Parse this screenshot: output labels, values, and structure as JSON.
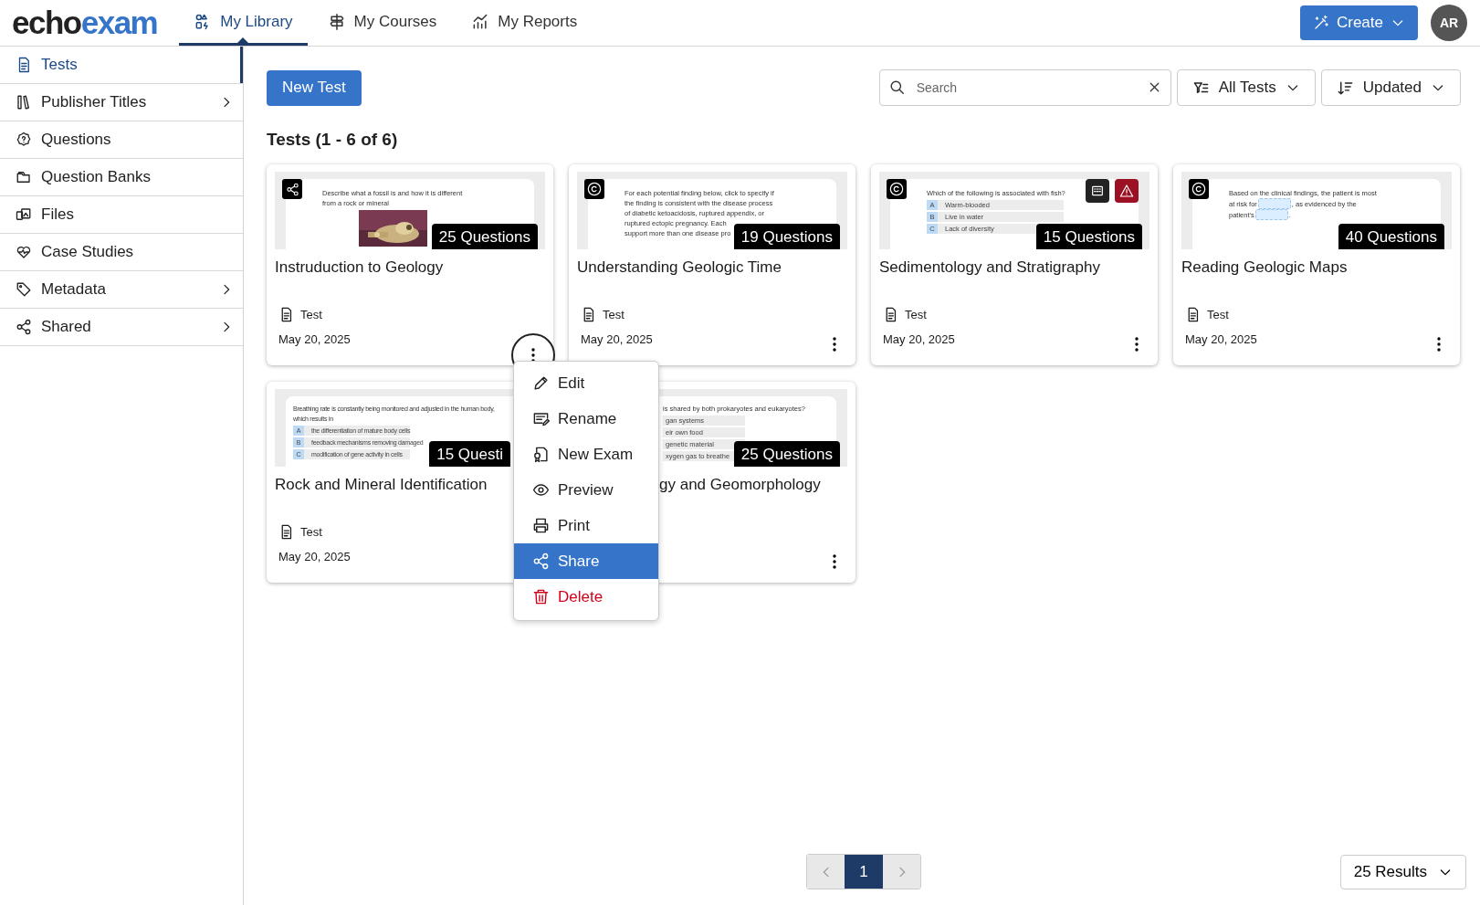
{
  "header": {
    "logo": [
      "echo",
      "exam"
    ],
    "nav": [
      {
        "label": "My Library",
        "selected": true
      },
      {
        "label": "My Courses",
        "selected": false
      },
      {
        "label": "My Reports",
        "selected": false
      }
    ],
    "create_button": "Create",
    "avatar": "AR"
  },
  "sidebar": {
    "items": [
      {
        "label": "Tests",
        "selected": true,
        "has_children": false
      },
      {
        "label": "Publisher Titles",
        "selected": false,
        "has_children": true
      },
      {
        "label": "Questions",
        "selected": false,
        "has_children": false
      },
      {
        "label": "Question Banks",
        "selected": false,
        "has_children": false
      },
      {
        "label": "Files",
        "selected": false,
        "has_children": false
      },
      {
        "label": "Case Studies",
        "selected": false,
        "has_children": false
      },
      {
        "label": "Metadata",
        "selected": false,
        "has_children": true
      },
      {
        "label": "Shared",
        "selected": false,
        "has_children": true
      }
    ]
  },
  "toolbar": {
    "new_button": "New Test",
    "search": {
      "placeholder": "Search"
    },
    "filter": "All Tests",
    "sort": "Updated"
  },
  "heading": "Tests (1 - 6 of 6)",
  "cards": [
    {
      "title": "Instruduction to Geology",
      "shared": true,
      "questions": "25 Questions",
      "type": "Test",
      "date": "May 20, 2025",
      "focused": true,
      "preview": {
        "lines": [
          [
            {
              "kind": "text",
              "text": "Describe what a fossil is and how it is different"
            }
          ],
          [
            {
              "kind": "text",
              "text": "from a rock or mineral"
            }
          ]
        ],
        "image": true
      }
    },
    {
      "title": "Understanding Geologic Time",
      "copyrighted": true,
      "questions": "19 Questions",
      "type": "Test",
      "date": "May 20, 2025",
      "preview": {
        "lines": [
          [
            {
              "kind": "text",
              "text": "For each potential finding below, click to specify if"
            }
          ],
          [
            {
              "kind": "text",
              "text": "the finding is consistent with the disease process"
            }
          ],
          [
            {
              "kind": "text",
              "text": "of diabetic ketoacidosis, ruptured appendix, or"
            }
          ],
          [
            {
              "kind": "text",
              "text": "ruptured ectopic pregnancy. Each"
            }
          ],
          [
            {
              "kind": "text",
              "text": "support more than one disease pro"
            }
          ]
        ]
      }
    },
    {
      "title": "Sedimentology and Stratigraphy",
      "copyrighted": true,
      "questions": "15 Questions",
      "type": "Test",
      "date": "May 20, 2025",
      "calculator": true,
      "warning": true,
      "preview": {
        "lines": [
          [
            {
              "kind": "text",
              "text": "Which of the following is associated with fish?"
            }
          ]
        ],
        "options": [
          {
            "letter": "A",
            "text": "Warm-blooded"
          },
          {
            "letter": "B",
            "text": "Live in water"
          },
          {
            "letter": "C",
            "text": "Lack of diversity"
          }
        ]
      }
    },
    {
      "title": "Reading Geologic Maps",
      "copyrighted": true,
      "questions": "40 Questions",
      "type": "Test",
      "date": "May 20, 2025",
      "preview": {
        "lines": [
          [
            {
              "kind": "text",
              "text": "Based on the clinical findings, the patient is most"
            }
          ],
          [
            {
              "kind": "text",
              "text": "at risk for"
            },
            {
              "kind": "blank"
            },
            {
              "kind": "text",
              "text": ", as evidenced by the"
            }
          ],
          [
            {
              "kind": "text",
              "text": "patient's"
            },
            {
              "kind": "blank"
            },
            {
              "kind": "text",
              "text": "."
            }
          ]
        ]
      }
    },
    {
      "title": "Rock and Mineral Identification",
      "questions": "15 Questi",
      "type": "Test",
      "date": "May 20, 2025",
      "right_covered": true,
      "preview": {
        "lines": [
          [
            {
              "kind": "text",
              "text": "Breathing rate is constantly being monitored and adjusted in the human body,"
            }
          ],
          [
            {
              "kind": "text",
              "text": "which results in"
            }
          ]
        ],
        "options": [
          {
            "letter": "A",
            "text": "the differentiation of mature body cells"
          },
          {
            "letter": "B",
            "text": "feedback mechanisms removing damaged"
          },
          {
            "letter": "C",
            "text": "modification of gene activity in cells"
          }
        ]
      }
    },
    {
      "title": "gy and Geomorphology",
      "questions": "25 Questions",
      "left_covered": true,
      "preview": {
        "lines": [
          [
            {
              "kind": "text",
              "text": "is shared by both prokaryotes and eukaryotes?"
            }
          ]
        ],
        "options": [
          {
            "text": "gan systems"
          },
          {
            "text": "eir own food"
          },
          {
            "text": "genetic material"
          },
          {
            "text": "xygen gas to breathe"
          }
        ]
      }
    }
  ],
  "menu": {
    "items": [
      {
        "label": "Edit",
        "kind": "normal",
        "selected": false
      },
      {
        "label": "Rename",
        "kind": "normal",
        "selected": false
      },
      {
        "label": "New Exam",
        "kind": "normal",
        "selected": false
      },
      {
        "label": "Preview",
        "kind": "normal",
        "selected": false
      },
      {
        "label": "Print",
        "kind": "normal",
        "selected": false
      },
      {
        "label": "Share",
        "kind": "normal",
        "selected": true
      },
      {
        "label": "Delete",
        "kind": "danger",
        "selected": false
      }
    ]
  },
  "pagination": {
    "prev_disabled": true,
    "next_disabled": true,
    "pages": [
      {
        "label": "1",
        "selected": true
      }
    ]
  },
  "results": "25 Results"
}
